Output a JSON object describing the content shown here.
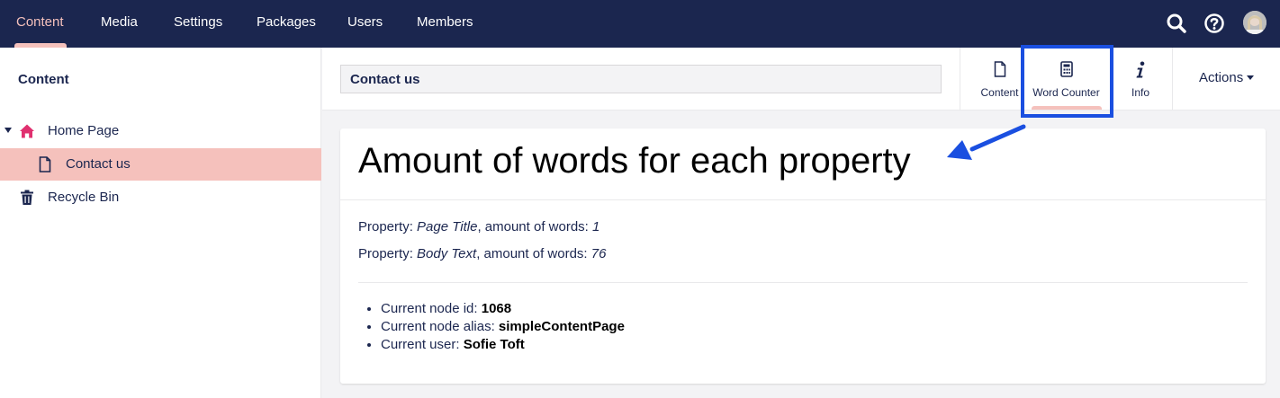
{
  "nav": {
    "items": [
      "Content",
      "Media",
      "Settings",
      "Packages",
      "Users",
      "Members"
    ],
    "active": "Content"
  },
  "sidebar": {
    "title": "Content",
    "tree": [
      {
        "label": "Home Page",
        "icon": "home-icon"
      },
      {
        "label": "Contact us",
        "icon": "document-icon"
      },
      {
        "label": "Recycle Bin",
        "icon": "trash-icon"
      }
    ]
  },
  "editor": {
    "node_name": "Contact us",
    "apps": [
      {
        "label": "Content",
        "icon": "document-icon"
      },
      {
        "label": "Word Counter",
        "icon": "calculator-icon"
      },
      {
        "label": "Info",
        "icon": "info-icon"
      }
    ],
    "actions_label": "Actions"
  },
  "panel": {
    "title": "Amount of words for each property",
    "properties": [
      {
        "prefix": "Property: ",
        "name": "Page Title",
        "middle": ", amount of words: ",
        "count": "1"
      },
      {
        "prefix": "Property: ",
        "name": "Body Text",
        "middle": ", amount of words: ",
        "count": "76"
      }
    ],
    "info": [
      {
        "label": "Current node id: ",
        "value": "1068"
      },
      {
        "label": "Current node alias: ",
        "value": "simpleContentPage"
      },
      {
        "label": "Current user: ",
        "value": "Sofie Toft"
      }
    ]
  },
  "colors": {
    "topbar": "#1b264f",
    "accent": "#f5c1bc",
    "home_icon": "#e0306f",
    "annotation": "#1a4fe0"
  }
}
